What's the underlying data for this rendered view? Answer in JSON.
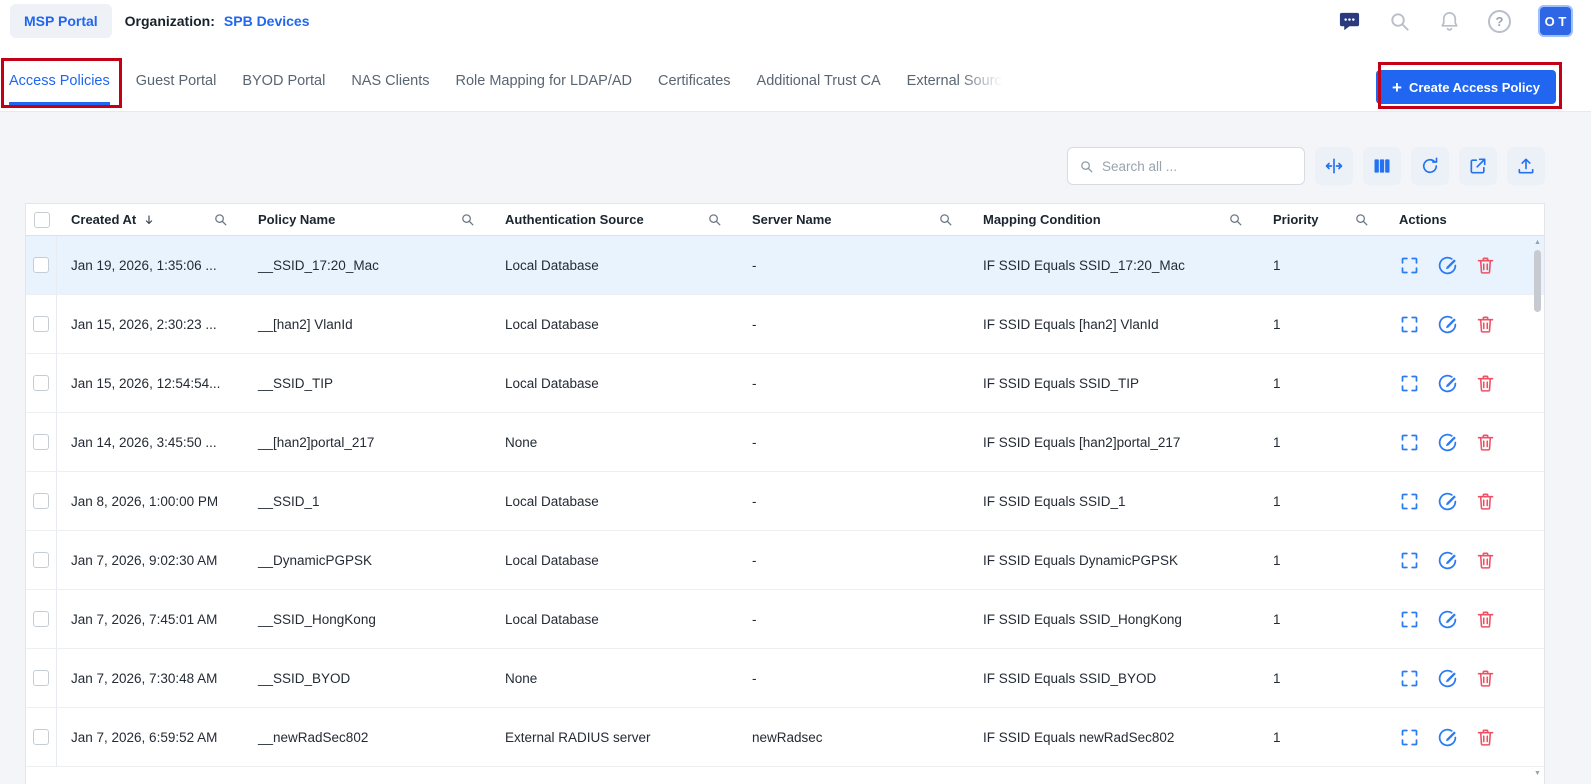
{
  "colors": {
    "accent_blue": "#2066f0",
    "annotation_red": "#c30016",
    "selected_row_bg": "#e9f3fd",
    "delete_icon_red": "#ef5064",
    "content_bg": "#f4f5f8"
  },
  "header": {
    "portal_button": "MSP Portal",
    "organization_label": "Organization:",
    "organization_name": "SPB Devices",
    "help_glyph": "?",
    "avatar": "O T"
  },
  "tabs": [
    {
      "label": "Access Policies",
      "active": true
    },
    {
      "label": "Guest Portal",
      "active": false
    },
    {
      "label": "BYOD Portal",
      "active": false
    },
    {
      "label": "NAS Clients",
      "active": false
    },
    {
      "label": "Role Mapping for LDAP/AD",
      "active": false
    },
    {
      "label": "Certificates",
      "active": false
    },
    {
      "label": "Additional Trust CA",
      "active": false
    },
    {
      "label": "External Source",
      "active": false
    }
  ],
  "create_button": {
    "plus": "+",
    "label": "Create Access Policy"
  },
  "toolbar": {
    "search_placeholder": "Search all ...",
    "icons": [
      "column-resize",
      "columns",
      "refresh",
      "open-external",
      "upload"
    ]
  },
  "table": {
    "columns": [
      "Created At",
      "Policy Name",
      "Authentication Source",
      "Server Name",
      "Mapping Condition",
      "Priority",
      "Actions"
    ],
    "rows": [
      {
        "created_at": "Jan 19, 2026, 1:35:06 ...",
        "policy_name": "__SSID_17:20_Mac",
        "auth_source": "Local Database",
        "server_name": "-",
        "mapping_condition": "IF SSID Equals SSID_17:20_Mac",
        "priority": "1",
        "selected": true
      },
      {
        "created_at": "Jan 15, 2026, 2:30:23 ...",
        "policy_name": "__[han2] VlanId",
        "auth_source": "Local Database",
        "server_name": "-",
        "mapping_condition": "IF SSID Equals [han2] VlanId",
        "priority": "1",
        "selected": false
      },
      {
        "created_at": "Jan 15, 2026, 12:54:54...",
        "policy_name": "__SSID_TIP",
        "auth_source": "Local Database",
        "server_name": "-",
        "mapping_condition": "IF SSID Equals SSID_TIP",
        "priority": "1",
        "selected": false
      },
      {
        "created_at": "Jan 14, 2026, 3:45:50 ...",
        "policy_name": "__[han2]portal_217",
        "auth_source": "None",
        "server_name": "-",
        "mapping_condition": "IF SSID Equals [han2]portal_217",
        "priority": "1",
        "selected": false
      },
      {
        "created_at": "Jan 8, 2026, 1:00:00 PM",
        "policy_name": "__SSID_1",
        "auth_source": "Local Database",
        "server_name": "-",
        "mapping_condition": "IF SSID Equals SSID_1",
        "priority": "1",
        "selected": false
      },
      {
        "created_at": "Jan 7, 2026, 9:02:30 AM",
        "policy_name": "__DynamicPGPSK",
        "auth_source": "Local Database",
        "server_name": "-",
        "mapping_condition": "IF SSID Equals DynamicPGPSK",
        "priority": "1",
        "selected": false
      },
      {
        "created_at": "Jan 7, 2026, 7:45:01 AM",
        "policy_name": "__SSID_HongKong",
        "auth_source": "Local Database",
        "server_name": "-",
        "mapping_condition": "IF SSID Equals SSID_HongKong",
        "priority": "1",
        "selected": false
      },
      {
        "created_at": "Jan 7, 2026, 7:30:48 AM",
        "policy_name": "__SSID_BYOD",
        "auth_source": "None",
        "server_name": "-",
        "mapping_condition": "IF SSID Equals SSID_BYOD",
        "priority": "1",
        "selected": false
      },
      {
        "created_at": "Jan 7, 2026, 6:59:52 AM",
        "policy_name": "__newRadSec802",
        "auth_source": "External RADIUS server",
        "server_name": "newRadsec",
        "mapping_condition": "IF SSID Equals newRadSec802",
        "priority": "1",
        "selected": false
      }
    ]
  },
  "scrollbar": {
    "up_glyph": "▲",
    "down_glyph": "▼"
  }
}
